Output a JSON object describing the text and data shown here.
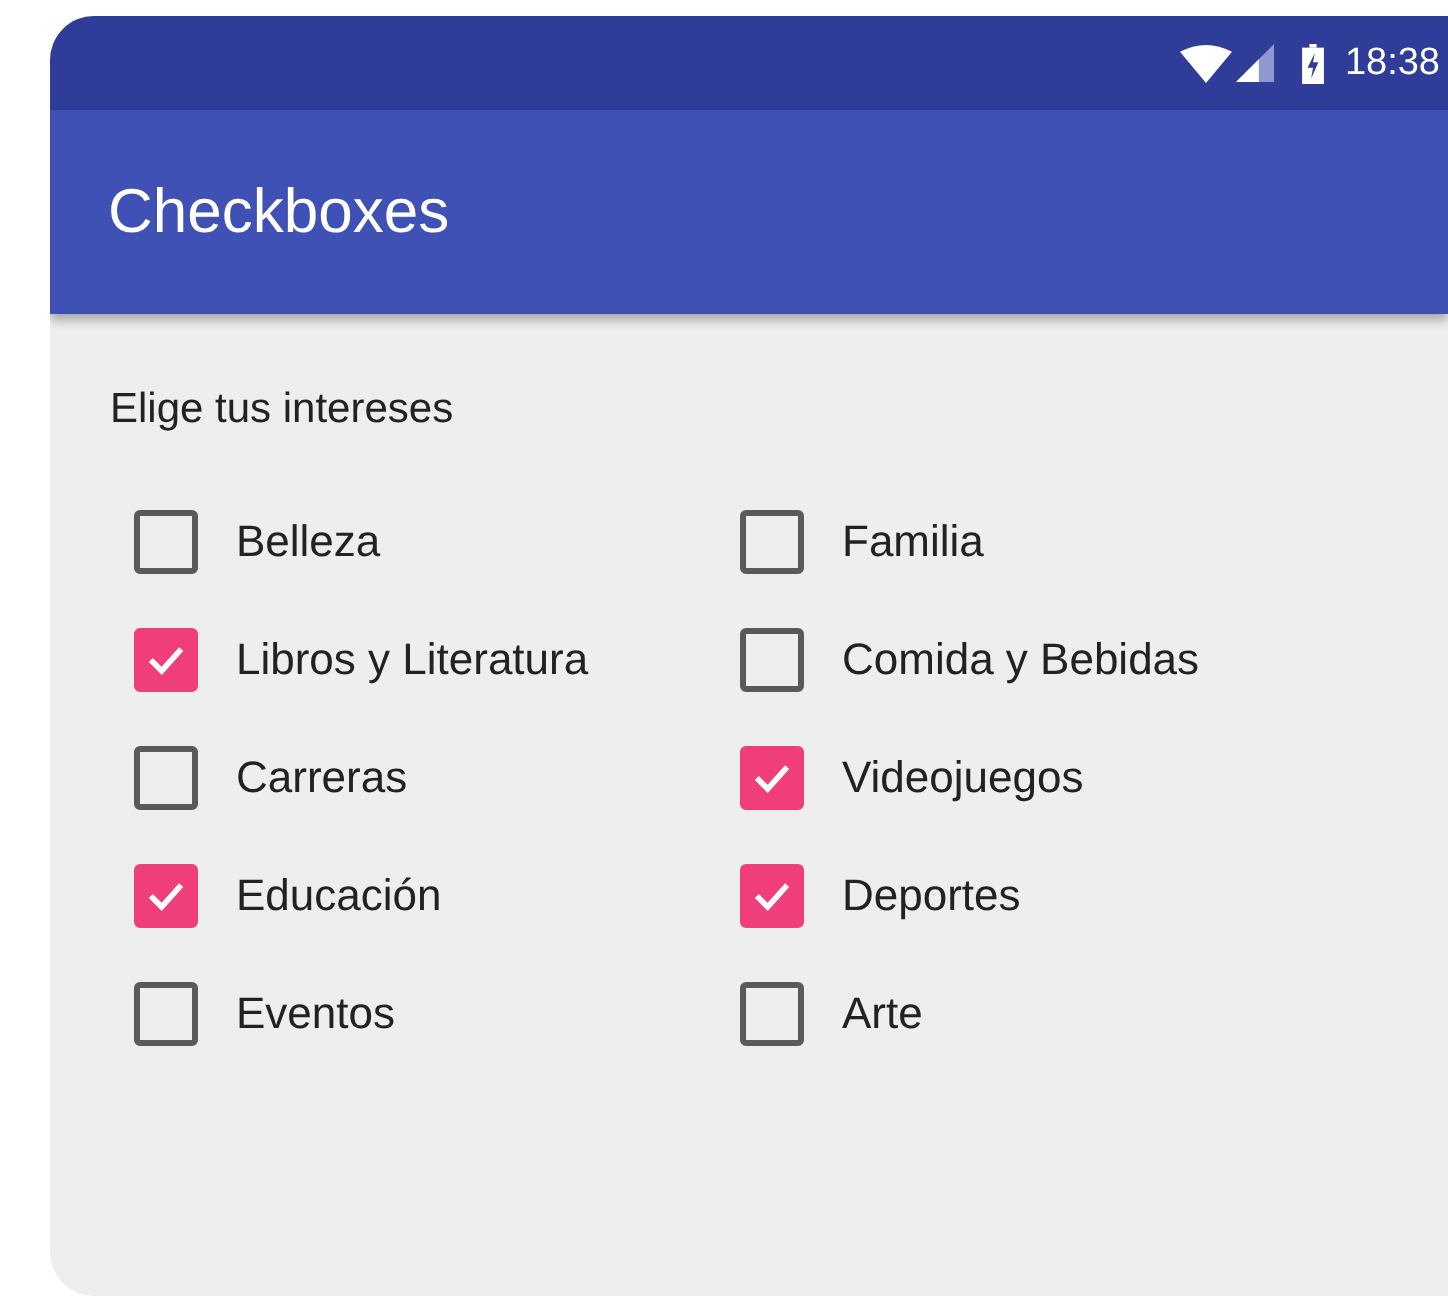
{
  "status_bar": {
    "time": "18:38"
  },
  "app_bar": {
    "title": "Checkboxes"
  },
  "prompt": "Elige tus intereses",
  "columns": [
    [
      {
        "label": "Belleza",
        "checked": false
      },
      {
        "label": "Libros y Literatura",
        "checked": true
      },
      {
        "label": "Carreras",
        "checked": false
      },
      {
        "label": "Educación",
        "checked": true
      },
      {
        "label": "Eventos",
        "checked": false
      }
    ],
    [
      {
        "label": "Familia",
        "checked": false
      },
      {
        "label": "Comida y Bebidas",
        "checked": false
      },
      {
        "label": "Videojuegos",
        "checked": true
      },
      {
        "label": "Deportes",
        "checked": true
      },
      {
        "label": "Arte",
        "checked": false
      }
    ]
  ]
}
